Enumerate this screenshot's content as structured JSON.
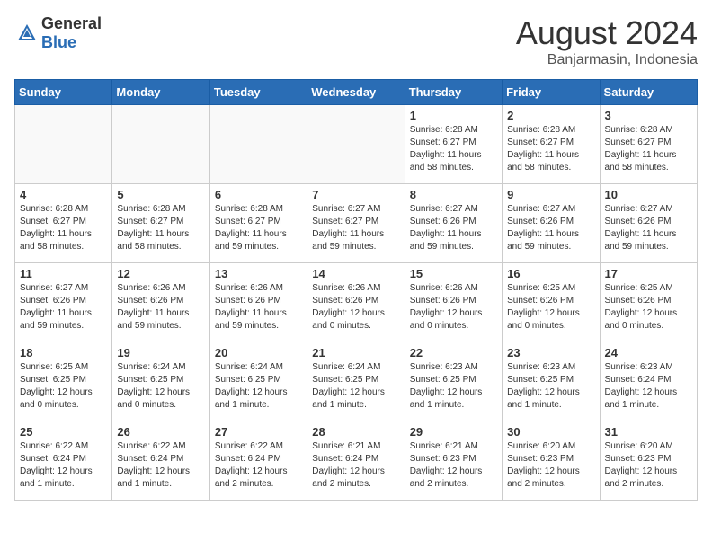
{
  "header": {
    "logo_general": "General",
    "logo_blue": "Blue",
    "month_year": "August 2024",
    "location": "Banjarmasin, Indonesia"
  },
  "days_of_week": [
    "Sunday",
    "Monday",
    "Tuesday",
    "Wednesday",
    "Thursday",
    "Friday",
    "Saturday"
  ],
  "weeks": [
    [
      {
        "day": "",
        "info": ""
      },
      {
        "day": "",
        "info": ""
      },
      {
        "day": "",
        "info": ""
      },
      {
        "day": "",
        "info": ""
      },
      {
        "day": "1",
        "info": "Sunrise: 6:28 AM\nSunset: 6:27 PM\nDaylight: 11 hours\nand 58 minutes."
      },
      {
        "day": "2",
        "info": "Sunrise: 6:28 AM\nSunset: 6:27 PM\nDaylight: 11 hours\nand 58 minutes."
      },
      {
        "day": "3",
        "info": "Sunrise: 6:28 AM\nSunset: 6:27 PM\nDaylight: 11 hours\nand 58 minutes."
      }
    ],
    [
      {
        "day": "4",
        "info": "Sunrise: 6:28 AM\nSunset: 6:27 PM\nDaylight: 11 hours\nand 58 minutes."
      },
      {
        "day": "5",
        "info": "Sunrise: 6:28 AM\nSunset: 6:27 PM\nDaylight: 11 hours\nand 58 minutes."
      },
      {
        "day": "6",
        "info": "Sunrise: 6:28 AM\nSunset: 6:27 PM\nDaylight: 11 hours\nand 59 minutes."
      },
      {
        "day": "7",
        "info": "Sunrise: 6:27 AM\nSunset: 6:27 PM\nDaylight: 11 hours\nand 59 minutes."
      },
      {
        "day": "8",
        "info": "Sunrise: 6:27 AM\nSunset: 6:26 PM\nDaylight: 11 hours\nand 59 minutes."
      },
      {
        "day": "9",
        "info": "Sunrise: 6:27 AM\nSunset: 6:26 PM\nDaylight: 11 hours\nand 59 minutes."
      },
      {
        "day": "10",
        "info": "Sunrise: 6:27 AM\nSunset: 6:26 PM\nDaylight: 11 hours\nand 59 minutes."
      }
    ],
    [
      {
        "day": "11",
        "info": "Sunrise: 6:27 AM\nSunset: 6:26 PM\nDaylight: 11 hours\nand 59 minutes."
      },
      {
        "day": "12",
        "info": "Sunrise: 6:26 AM\nSunset: 6:26 PM\nDaylight: 11 hours\nand 59 minutes."
      },
      {
        "day": "13",
        "info": "Sunrise: 6:26 AM\nSunset: 6:26 PM\nDaylight: 11 hours\nand 59 minutes."
      },
      {
        "day": "14",
        "info": "Sunrise: 6:26 AM\nSunset: 6:26 PM\nDaylight: 12 hours\nand 0 minutes."
      },
      {
        "day": "15",
        "info": "Sunrise: 6:26 AM\nSunset: 6:26 PM\nDaylight: 12 hours\nand 0 minutes."
      },
      {
        "day": "16",
        "info": "Sunrise: 6:25 AM\nSunset: 6:26 PM\nDaylight: 12 hours\nand 0 minutes."
      },
      {
        "day": "17",
        "info": "Sunrise: 6:25 AM\nSunset: 6:26 PM\nDaylight: 12 hours\nand 0 minutes."
      }
    ],
    [
      {
        "day": "18",
        "info": "Sunrise: 6:25 AM\nSunset: 6:25 PM\nDaylight: 12 hours\nand 0 minutes."
      },
      {
        "day": "19",
        "info": "Sunrise: 6:24 AM\nSunset: 6:25 PM\nDaylight: 12 hours\nand 0 minutes."
      },
      {
        "day": "20",
        "info": "Sunrise: 6:24 AM\nSunset: 6:25 PM\nDaylight: 12 hours\nand 1 minute."
      },
      {
        "day": "21",
        "info": "Sunrise: 6:24 AM\nSunset: 6:25 PM\nDaylight: 12 hours\nand 1 minute."
      },
      {
        "day": "22",
        "info": "Sunrise: 6:23 AM\nSunset: 6:25 PM\nDaylight: 12 hours\nand 1 minute."
      },
      {
        "day": "23",
        "info": "Sunrise: 6:23 AM\nSunset: 6:25 PM\nDaylight: 12 hours\nand 1 minute."
      },
      {
        "day": "24",
        "info": "Sunrise: 6:23 AM\nSunset: 6:24 PM\nDaylight: 12 hours\nand 1 minute."
      }
    ],
    [
      {
        "day": "25",
        "info": "Sunrise: 6:22 AM\nSunset: 6:24 PM\nDaylight: 12 hours\nand 1 minute."
      },
      {
        "day": "26",
        "info": "Sunrise: 6:22 AM\nSunset: 6:24 PM\nDaylight: 12 hours\nand 1 minute."
      },
      {
        "day": "27",
        "info": "Sunrise: 6:22 AM\nSunset: 6:24 PM\nDaylight: 12 hours\nand 2 minutes."
      },
      {
        "day": "28",
        "info": "Sunrise: 6:21 AM\nSunset: 6:24 PM\nDaylight: 12 hours\nand 2 minutes."
      },
      {
        "day": "29",
        "info": "Sunrise: 6:21 AM\nSunset: 6:23 PM\nDaylight: 12 hours\nand 2 minutes."
      },
      {
        "day": "30",
        "info": "Sunrise: 6:20 AM\nSunset: 6:23 PM\nDaylight: 12 hours\nand 2 minutes."
      },
      {
        "day": "31",
        "info": "Sunrise: 6:20 AM\nSunset: 6:23 PM\nDaylight: 12 hours\nand 2 minutes."
      }
    ]
  ]
}
